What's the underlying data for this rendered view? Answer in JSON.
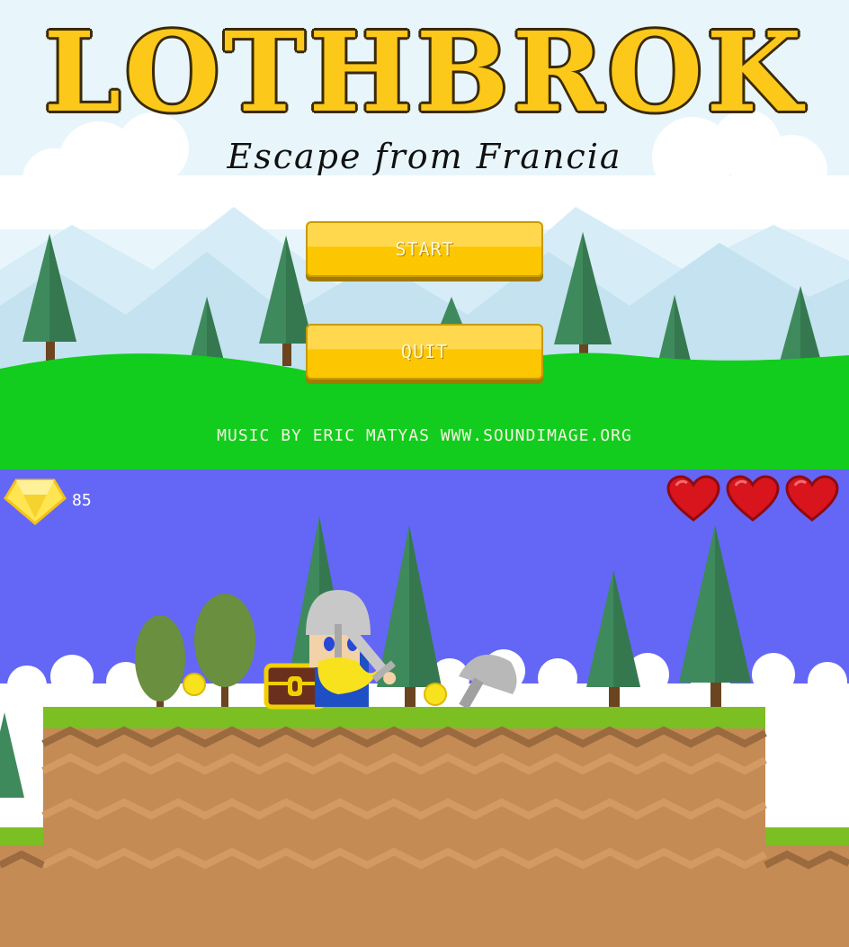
{
  "menu": {
    "title": "LOTHBROK",
    "subtitle": "Escape from Francia",
    "start_label": "START",
    "quit_label": "QUIT",
    "credits": "MUSIC BY ERIC MATYAS WWW.SOUNDIMAGE.ORG"
  },
  "hud": {
    "gem_icon": "gem-icon",
    "gem_count": "85",
    "lives": 3,
    "heart_icon": "heart-icon"
  },
  "colors": {
    "sky_menu": "#e8f6fc",
    "sky_game": "#6466f6",
    "grass": "#12cc1e",
    "button": "#fcc600",
    "title": "#fcc81a",
    "heart": "#d8141c"
  }
}
